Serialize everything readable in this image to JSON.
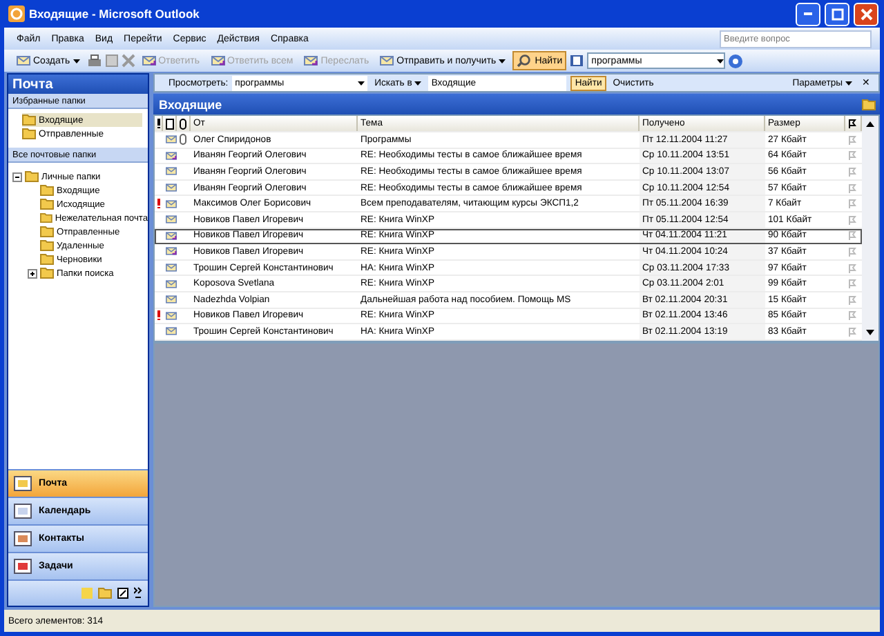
{
  "window": {
    "title": "Входящие - Microsoft Outlook"
  },
  "menu": [
    "Файл",
    "Правка",
    "Вид",
    "Перейти",
    "Сервис",
    "Действия",
    "Справка"
  ],
  "help_search": {
    "placeholder": "Введите вопрос"
  },
  "toolbar": [
    {
      "label": "Создать",
      "disabled": false,
      "selected": false,
      "dropdown": true
    },
    {
      "label": "Ответить",
      "disabled": true,
      "selected": false,
      "dropdown": false
    },
    {
      "label": "Ответить всем",
      "disabled": true,
      "selected": false,
      "dropdown": false
    },
    {
      "label": "Переслать",
      "disabled": true,
      "selected": false,
      "dropdown": false
    },
    {
      "label": "Отправить и получить",
      "disabled": false,
      "selected": false,
      "dropdown": true
    },
    {
      "label": "Найти",
      "disabled": false,
      "selected": true,
      "dropdown": false
    }
  ],
  "address_combo": {
    "value": "программы"
  },
  "sidebar": {
    "title": "Почта",
    "favorites_title": "Избранные папки",
    "favorites": [
      {
        "label": "Входящие",
        "selected": true
      },
      {
        "label": "Отправленные",
        "selected": false
      }
    ],
    "all_title": "Все почтовые папки",
    "tree": [
      {
        "label": "Личные папки",
        "expanded": true,
        "children": [
          {
            "label": "Входящие"
          },
          {
            "label": "Исходящие"
          },
          {
            "label": "Нежелательная почта"
          },
          {
            "label": "Отправленные"
          },
          {
            "label": "Удаленные"
          },
          {
            "label": "Черновики"
          },
          {
            "label": "Папки поиска",
            "expanded": false
          }
        ]
      }
    ],
    "nav": [
      {
        "label": "Почта",
        "selected": true
      },
      {
        "label": "Календарь",
        "selected": false
      },
      {
        "label": "Контакты",
        "selected": false
      },
      {
        "label": "Задачи",
        "selected": false
      }
    ]
  },
  "find_bar": {
    "look_label": "Просмотреть:",
    "look_value": "программы",
    "search_in": "Искать в",
    "folder": "Входящие",
    "find": "Найти",
    "clear": "Очистить",
    "options": "Параметры",
    "close": "✕"
  },
  "folder_title": "Входящие",
  "table": {
    "columns": [
      "От",
      "Тема",
      "Получено",
      "Размер"
    ],
    "rows": [
      {
        "important": false,
        "replied": false,
        "attachment": true,
        "from": "Олег Спиридонов",
        "subject": "Программы",
        "received": "Пт 12.11.2004 11:27",
        "size": "27 Кбайт",
        "selected": false
      },
      {
        "important": false,
        "replied": true,
        "attachment": false,
        "from": "Иванян Георгий Олегович",
        "subject": "RE: Необходимы тесты в самое ближайшее время",
        "received": "Ср 10.11.2004 13:51",
        "size": "64 Кбайт",
        "selected": false
      },
      {
        "important": false,
        "replied": false,
        "attachment": false,
        "from": "Иванян Георгий Олегович",
        "subject": "RE: Необходимы тесты в самое ближайшее время",
        "received": "Ср 10.11.2004 13:07",
        "size": "56 Кбайт",
        "selected": false
      },
      {
        "important": false,
        "replied": false,
        "attachment": false,
        "from": "Иванян Георгий Олегович",
        "subject": "RE: Необходимы тесты в самое ближайшее время",
        "received": "Ср 10.11.2004 12:54",
        "size": "57 Кбайт",
        "selected": false
      },
      {
        "important": true,
        "replied": false,
        "attachment": false,
        "from": "Максимов Олег Борисович",
        "subject": "Всем преподавателям, читающим курсы ЭКСП1,2",
        "received": "Пт 05.11.2004 16:39",
        "size": "7 Кбайт",
        "selected": false
      },
      {
        "important": false,
        "replied": false,
        "attachment": false,
        "from": "Новиков Павел Игоревич",
        "subject": "RE: Книга WinXP",
        "received": "Пт 05.11.2004 12:54",
        "size": "101 Кбайт",
        "selected": false
      },
      {
        "important": false,
        "replied": true,
        "attachment": false,
        "from": "Новиков Павел Игоревич",
        "subject": "RE: Книга WinXP",
        "received": "Чт 04.11.2004 11:21",
        "size": "90 Кбайт",
        "selected": true
      },
      {
        "important": false,
        "replied": true,
        "attachment": false,
        "from": "Новиков Павел Игоревич",
        "subject": "RE: Книга WinXP",
        "received": "Чт 04.11.2004 10:24",
        "size": "37 Кбайт",
        "selected": false
      },
      {
        "important": false,
        "replied": false,
        "attachment": false,
        "from": "Трошин Сергей Константинович",
        "subject": "НА: Книга WinXP",
        "received": "Ср 03.11.2004 17:33",
        "size": "97 Кбайт",
        "selected": false
      },
      {
        "important": false,
        "replied": false,
        "attachment": false,
        "from": "Koposova Svetlana",
        "subject": "RE: Книга WinXP",
        "received": "Ср 03.11.2004 2:01",
        "size": "99 Кбайт",
        "selected": false
      },
      {
        "important": false,
        "replied": false,
        "attachment": false,
        "from": "Nadezhda Volpian",
        "subject": "Дальнейшая работа над пособием. Помощь MS",
        "received": "Вт 02.11.2004 20:31",
        "size": "15 Кбайт",
        "selected": false
      },
      {
        "important": true,
        "replied": false,
        "attachment": false,
        "from": "Новиков Павел Игоревич",
        "subject": "RE: Книга WinXP",
        "received": "Вт 02.11.2004 13:46",
        "size": "85 Кбайт",
        "selected": false
      },
      {
        "important": false,
        "replied": false,
        "attachment": false,
        "from": "Трошин Сергей Константинович",
        "subject": "НА: Книга WinXP",
        "received": "Вт 02.11.2004 13:19",
        "size": "83 Кбайт",
        "selected": false
      }
    ]
  },
  "status_bar": "Всего элементов: 314"
}
